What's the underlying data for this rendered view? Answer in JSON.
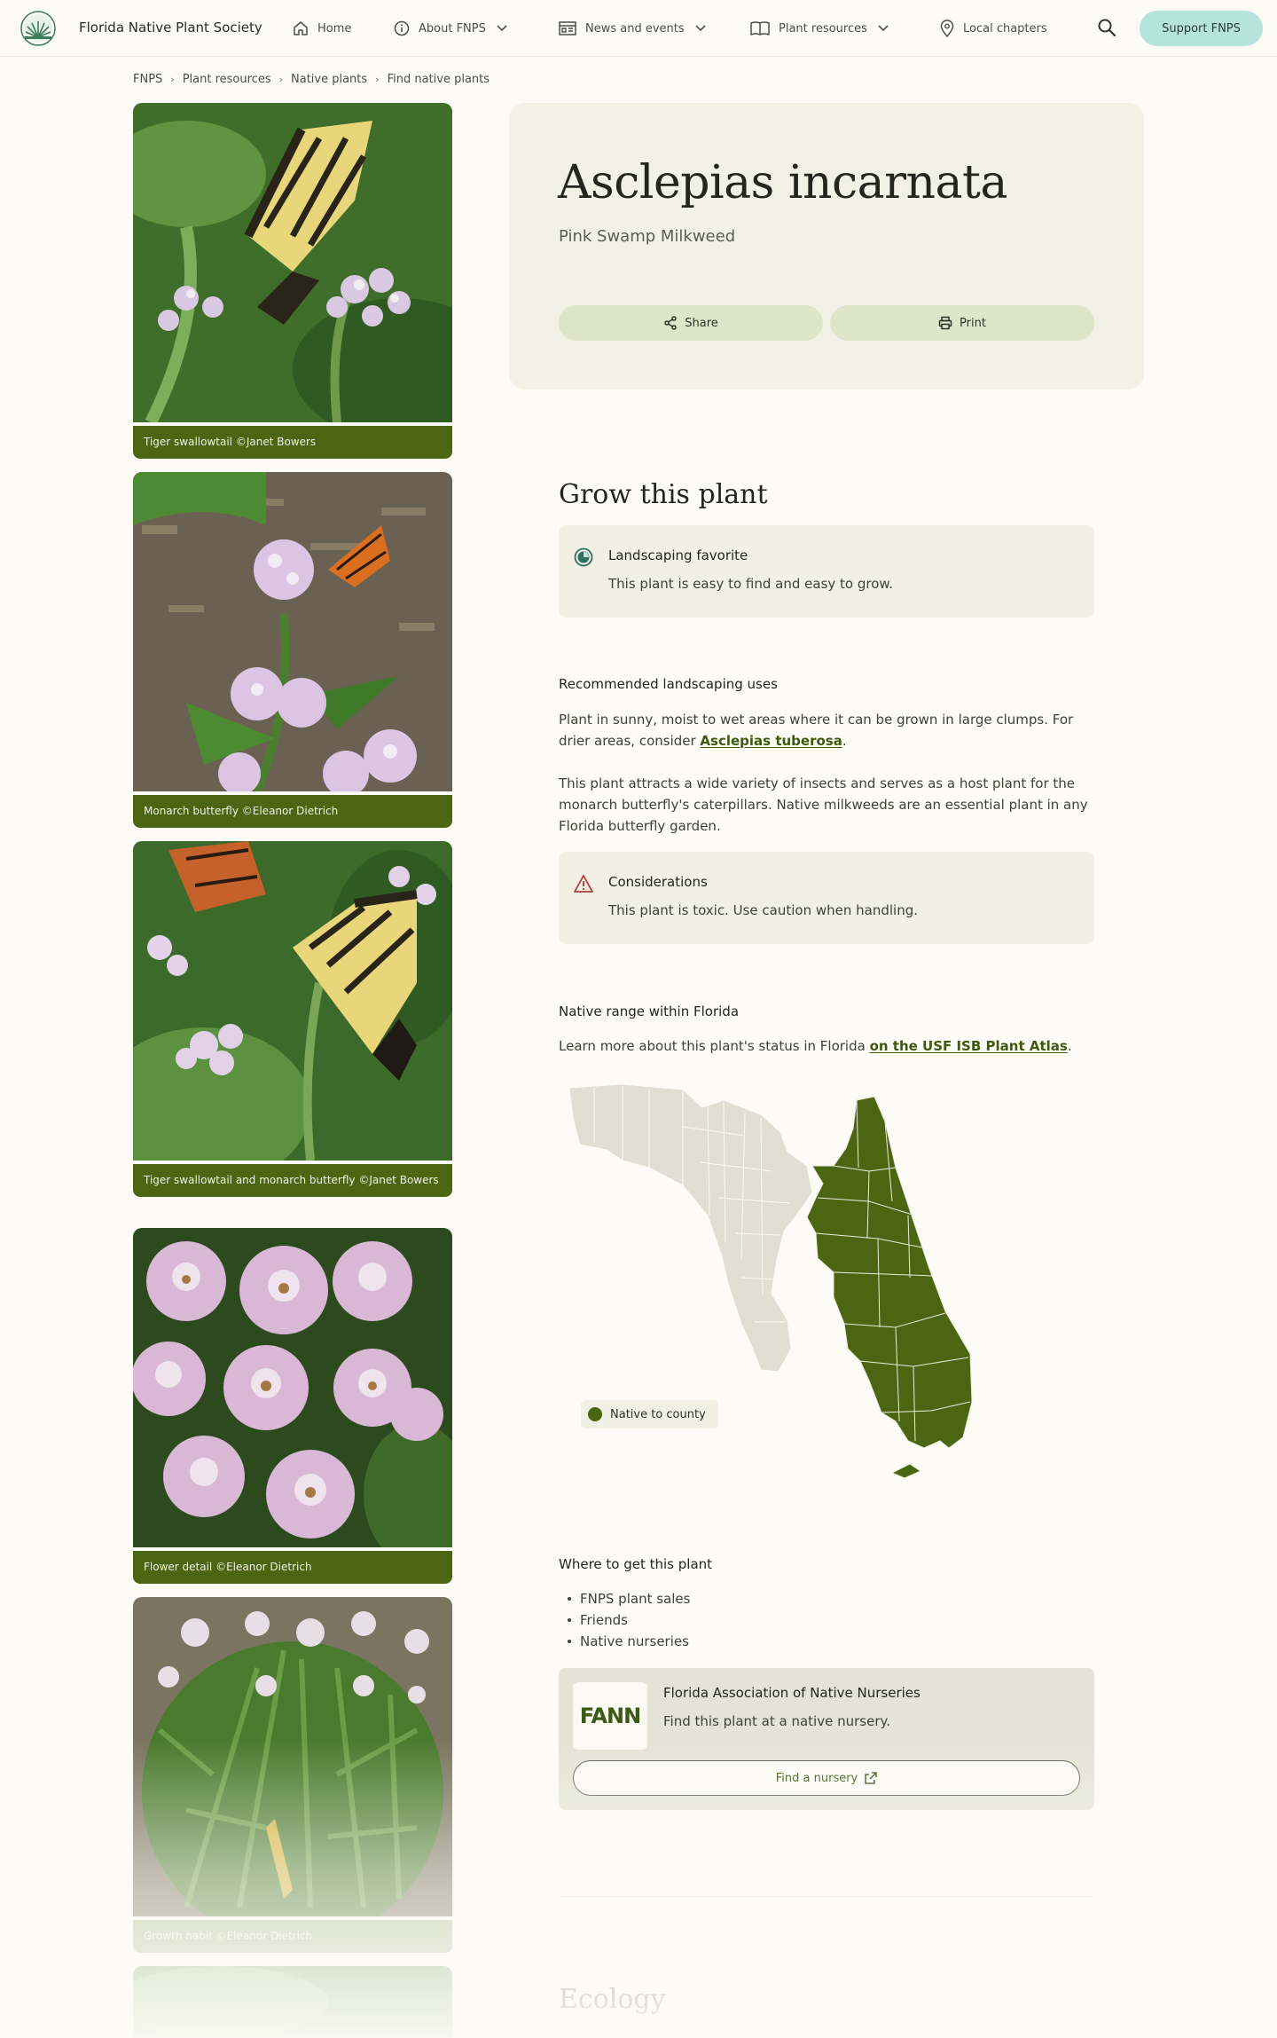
{
  "header": {
    "brand": "Florida Native Plant Society",
    "nav": {
      "home": "Home",
      "about": "About FNPS",
      "news": "News and events",
      "resources": "Plant resources",
      "chapters": "Local chapters"
    },
    "support_label": "Support FNPS"
  },
  "breadcrumb": [
    "FNPS",
    "Plant resources",
    "Native plants",
    "Find native plants"
  ],
  "gallery": [
    {
      "caption": "Tiger swallowtail ©Janet Bowers"
    },
    {
      "caption": "Monarch butterfly ©Eleanor Dietrich"
    },
    {
      "caption": "Tiger swallowtail and monarch butterfly ©Janet Bowers"
    },
    {
      "caption": "Flower detail ©Eleanor Dietrich"
    },
    {
      "caption": "Growth habit ©Eleanor Dietrich"
    }
  ],
  "plant": {
    "scientific_name": "Asclepias incarnata",
    "common_name": "Pink Swamp Milkweed",
    "share_label": "Share",
    "print_label": "Print"
  },
  "grow": {
    "heading": "Grow this plant",
    "favorite": {
      "title": "Landscaping favorite",
      "desc": "This plant is easy to find and easy to grow."
    },
    "uses_heading": "Recommended landscaping uses",
    "uses_p1_before": "Plant in sunny, moist to wet areas where it can be grown in large clumps. For drier areas, consider ",
    "uses_p1_link": "Asclepias tuberosa",
    "uses_p1_after": ".",
    "uses_p2": "This plant attracts a wide variety of insects and serves as a host plant for the monarch butterfly's caterpillars. Native milkweeds are an essential plant in any Florida butterfly garden.",
    "considerations": {
      "title": "Considerations",
      "desc": "This plant is toxic. Use caution when handling."
    },
    "range_heading": "Native range within Florida",
    "range_text": "Learn more about this plant's status in Florida ",
    "range_link": "on the USF ISB Plant Atlas",
    "range_after": ".",
    "legend_label": "Native to county",
    "where_heading": "Where to get this plant",
    "where_items": [
      "FNPS plant sales",
      "Friends",
      "Native nurseries"
    ],
    "fann": {
      "logo_text": "FANN",
      "title": "Florida Association of Native Nurseries",
      "desc": "Find this plant at a native nursery.",
      "button": "Find a nursery"
    }
  },
  "ecology": {
    "heading": "Ecology"
  },
  "colors": {
    "accent": "#4c6512",
    "support_bg": "#b6e3dc",
    "card_bg": "#f1f1e5",
    "page_bg": "#fcfbf5"
  },
  "icons": [
    "home-icon",
    "info-icon",
    "news-icon",
    "book-icon",
    "location-pin-icon",
    "search-icon",
    "chevron-down-icon",
    "share-icon",
    "print-icon",
    "favorite-badge-icon",
    "warning-icon",
    "external-link-icon"
  ]
}
